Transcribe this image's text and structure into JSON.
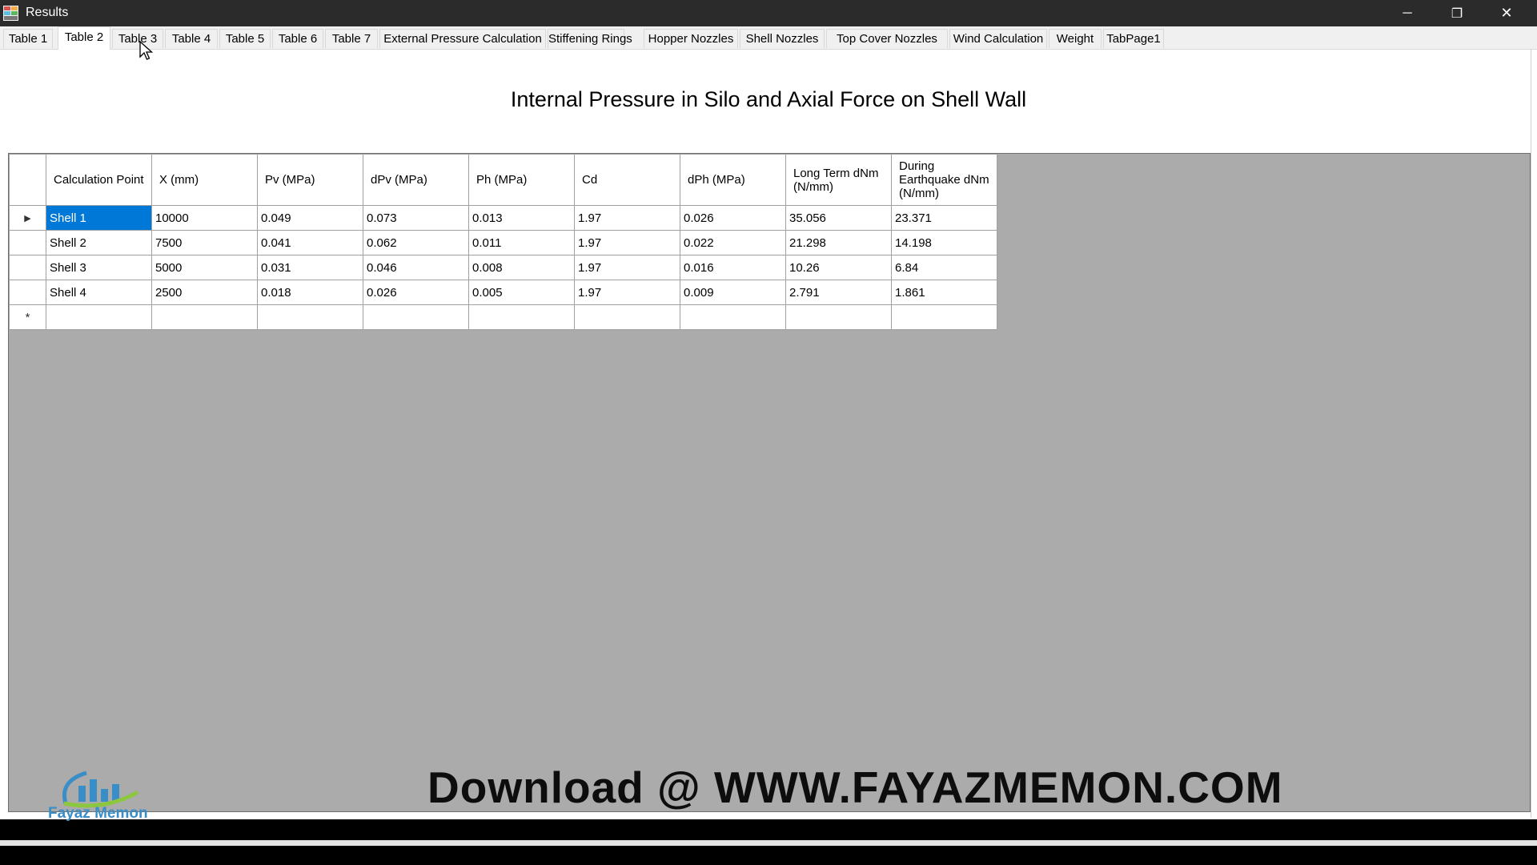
{
  "window": {
    "title": "Results",
    "minimize_glyph": "─",
    "restore_glyph": "❐",
    "close_glyph": "✕"
  },
  "tabs": [
    {
      "label": "Table 1",
      "active": false
    },
    {
      "label": "Table 2",
      "active": true
    },
    {
      "label": "Table 3",
      "active": false
    },
    {
      "label": "Table 4",
      "active": false
    },
    {
      "label": "Table 5",
      "active": false
    },
    {
      "label": "Table 6",
      "active": false
    },
    {
      "label": "Table 7",
      "active": false
    },
    {
      "label": "External Pressure Calculation",
      "active": false
    },
    {
      "label": "Stiffening Rings",
      "active": false
    },
    {
      "label": "Hopper Nozzles",
      "active": false
    },
    {
      "label": "Shell Nozzles",
      "active": false
    },
    {
      "label": "Top Cover Nozzles",
      "active": false
    },
    {
      "label": "Wind Calculation",
      "active": false
    },
    {
      "label": "Weight",
      "active": false
    },
    {
      "label": "TabPage1",
      "active": false
    }
  ],
  "page_title": "Internal Pressure in Silo and Axial Force on Shell Wall",
  "grid": {
    "headers": [
      "Calculation Point",
      "X (mm)",
      "Pv (MPa)",
      "dPv (MPa)",
      "Ph (MPa)",
      "Cd",
      "dPh (MPa)",
      "Long Term dNm (N/mm)",
      "During Earthquake dNm (N/mm)"
    ],
    "rows": [
      [
        "Shell 1",
        "10000",
        "0.049",
        "0.073",
        "0.013",
        "1.97",
        "0.026",
        "35.056",
        "23.371"
      ],
      [
        "Shell 2",
        "7500",
        "0.041",
        "0.062",
        "0.011",
        "1.97",
        "0.022",
        "21.298",
        "14.198"
      ],
      [
        "Shell 3",
        "5000",
        "0.031",
        "0.046",
        "0.008",
        "1.97",
        "0.016",
        "10.26",
        "6.84"
      ],
      [
        "Shell 4",
        "2500",
        "0.018",
        "0.026",
        "0.005",
        "1.97",
        "0.009",
        "2.791",
        "1.861"
      ]
    ],
    "current_row_marker": "▶",
    "new_row_marker": "*",
    "selected_cell": {
      "row": 0,
      "col": 0
    }
  },
  "watermark": {
    "download_text": "Download @ WWW.FAYAZMEMON.COM",
    "logo_text": "Fayaz Memon"
  },
  "colors": {
    "selection": "#0078d7",
    "grid_background": "#ababab",
    "titlebar": "#2b2b2b",
    "logo_blue": "#3a8ec8",
    "logo_green": "#8dc63f"
  }
}
